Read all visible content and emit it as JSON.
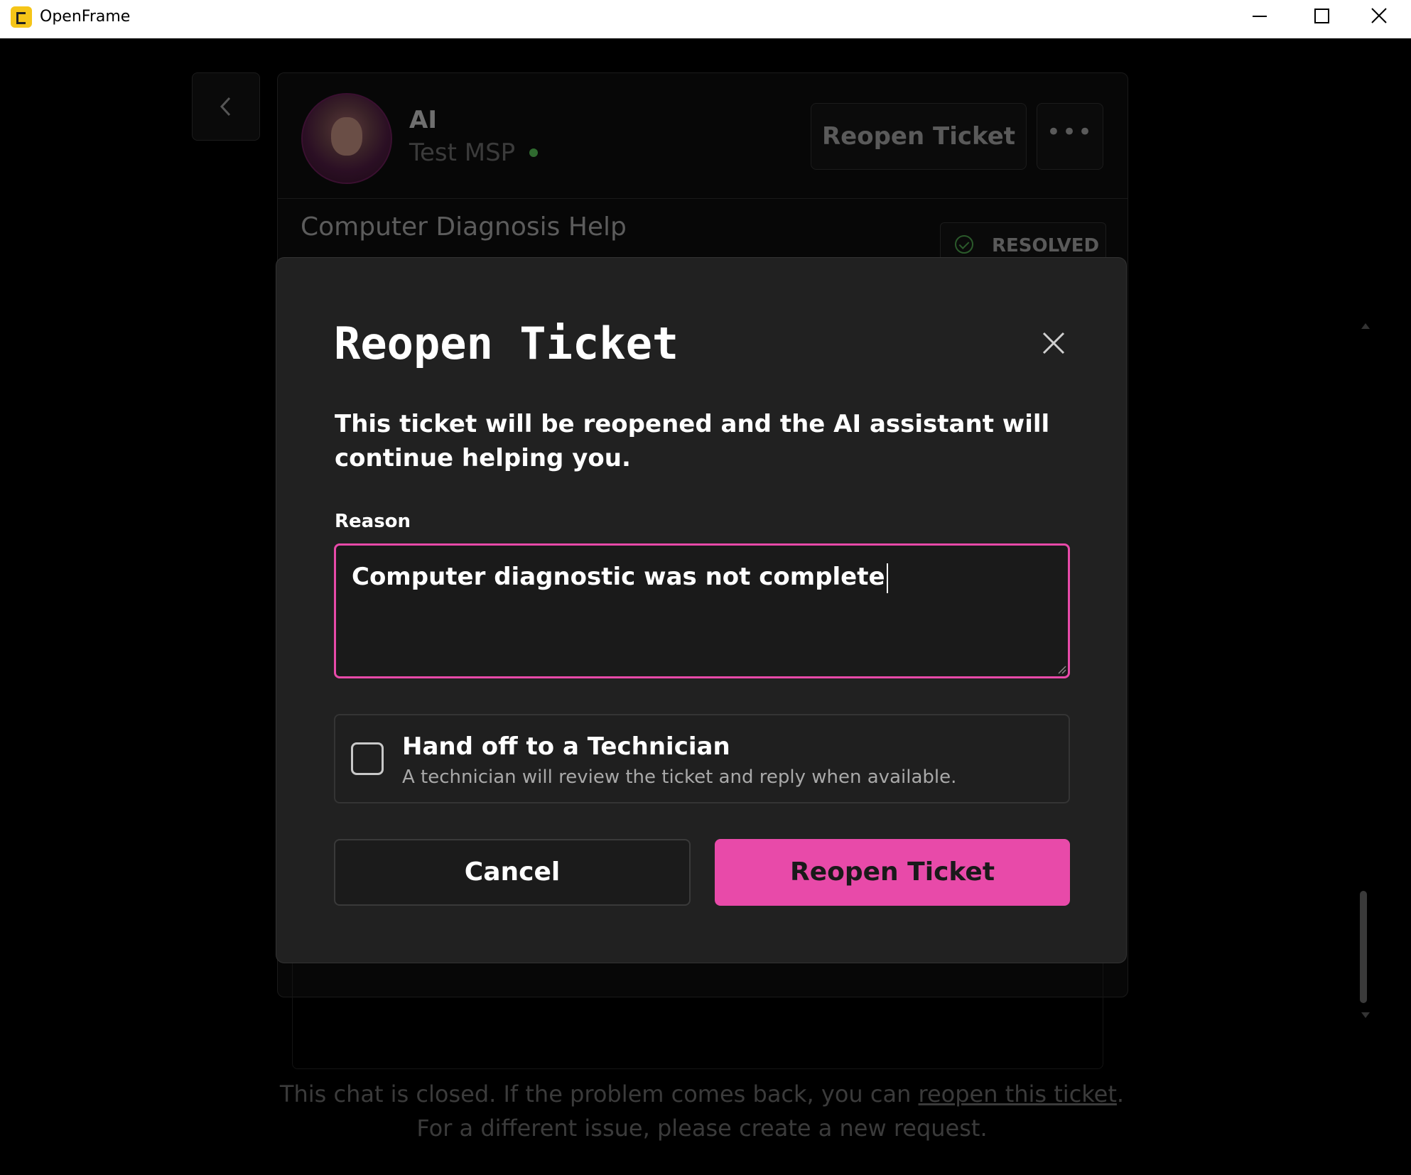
{
  "window": {
    "title": "OpenFrame"
  },
  "header": {
    "agent_name": "AI",
    "organization": "Test MSP",
    "reopen_button": "Reopen Ticket",
    "more_button": "•••"
  },
  "ticket": {
    "title": "Computer Diagnosis Help",
    "status": "RESOLVED"
  },
  "modal": {
    "title": "Reopen Ticket",
    "description": "This ticket will be reopened and the AI assistant will continue helping you.",
    "reason_label": "Reason",
    "reason_value": "Computer diagnostic was not complete",
    "handoff_title": "Hand off to a Technician",
    "handoff_subtitle": "A technician will review the ticket and reply when available.",
    "handoff_checked": false,
    "cancel_label": "Cancel",
    "confirm_label": "Reopen Ticket"
  },
  "footer": {
    "note_before": "This chat is closed. If the problem comes back, you can ",
    "note_link": "reopen this ticket",
    "note_after": ". For a different issue, please create a new request."
  },
  "colors": {
    "accent": "#e84aa9",
    "modal_bg": "#212121",
    "page_bg": "#000000"
  }
}
